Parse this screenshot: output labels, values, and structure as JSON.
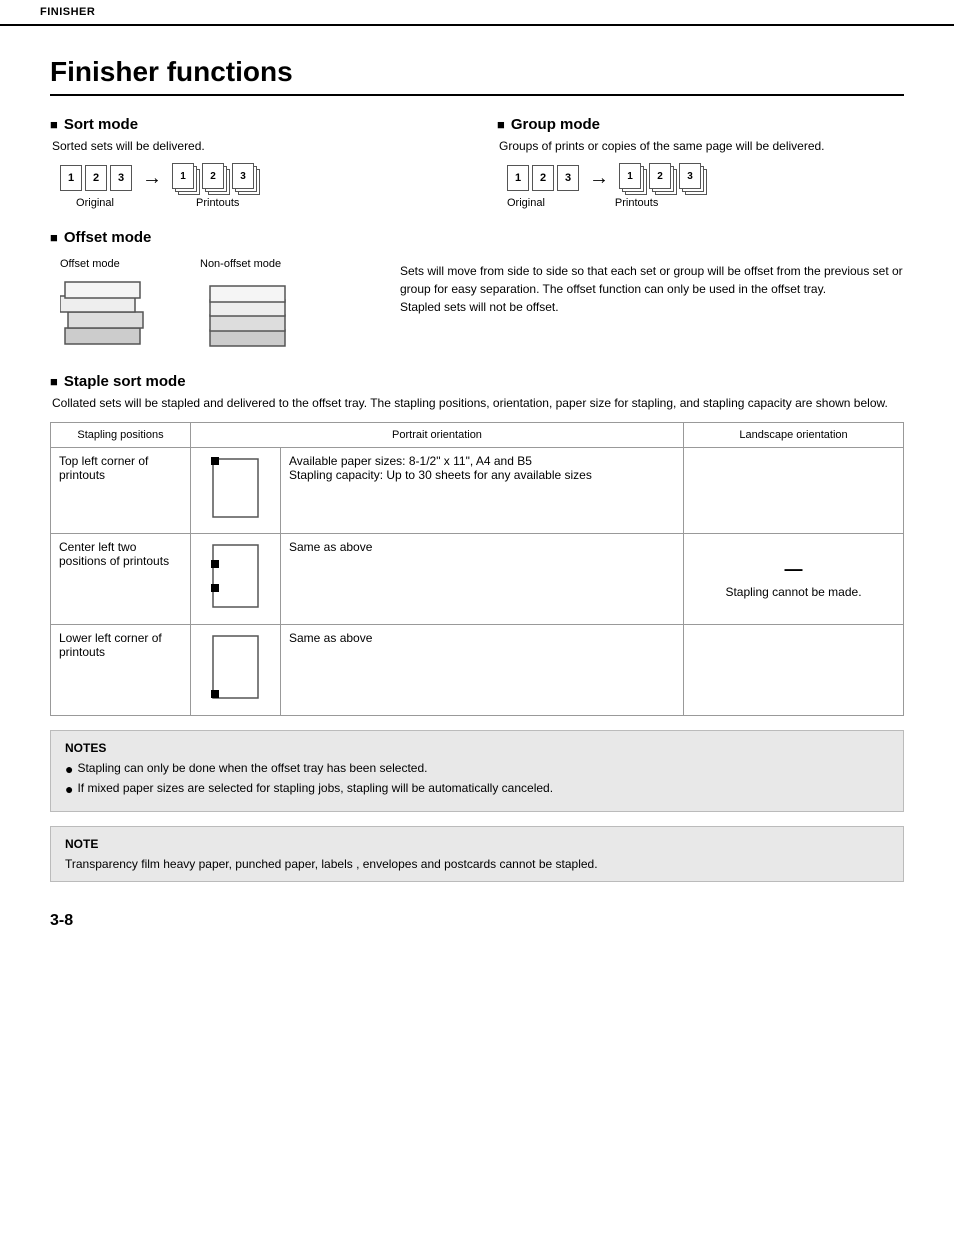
{
  "header": {
    "label": "FINISHER"
  },
  "page": {
    "title": "Finisher functions",
    "sort_mode": {
      "heading": "Sort mode",
      "desc": "Sorted sets will be delivered.",
      "original_label": "Original",
      "printouts_label": "Printouts",
      "pages": [
        "1",
        "2",
        "3"
      ]
    },
    "group_mode": {
      "heading": "Group mode",
      "desc": "Groups of prints or copies of the same page will be delivered.",
      "original_label": "Original",
      "printouts_label": "Printouts",
      "pages": [
        "1",
        "2",
        "3"
      ]
    },
    "offset_mode": {
      "heading": "Offset mode",
      "offset_label": "Offset mode",
      "non_offset_label": "Non-offset mode",
      "desc": "Sets will move from side to side so that each set or group will be offset from the previous set or group for easy separation. The offset function can only be used in the offset tray.\nStapled sets will not be offset."
    },
    "staple_sort_mode": {
      "heading": "Staple sort mode",
      "desc": "Collated sets will be stapled and delivered to the offset tray. The stapling positions, orientation, paper size for stapling, and stapling capacity are shown below.",
      "table": {
        "headers": [
          "Stapling positions",
          "Portrait orientation",
          "Landscape orientation"
        ],
        "rows": [
          {
            "position": "Top left corner of printouts",
            "portrait_desc": "Available paper sizes: 8-1/2\" x 11\", A4 and B5\nStapling capacity: Up to 30 sheets for any available sizes",
            "landscape_desc": "",
            "staple_location": "top-left"
          },
          {
            "position": "Center left two positions of printouts",
            "portrait_desc": "Same as above",
            "landscape_desc": "Stapling cannot be made.",
            "staple_location": "center-left",
            "has_dash": true
          },
          {
            "position": "Lower left corner of printouts",
            "portrait_desc": "Same as above",
            "landscape_desc": "",
            "staple_location": "bottom-left"
          }
        ]
      }
    },
    "notes": {
      "title": "NOTES",
      "items": [
        "Stapling can only be done when the offset tray has been selected.",
        "If mixed paper sizes are selected for stapling jobs, stapling will be automatically canceled."
      ]
    },
    "note2": {
      "title": "NOTE",
      "text": "Transparency film heavy paper, punched paper, labels , envelopes and postcards cannot be stapled."
    },
    "page_number": "3-8"
  }
}
